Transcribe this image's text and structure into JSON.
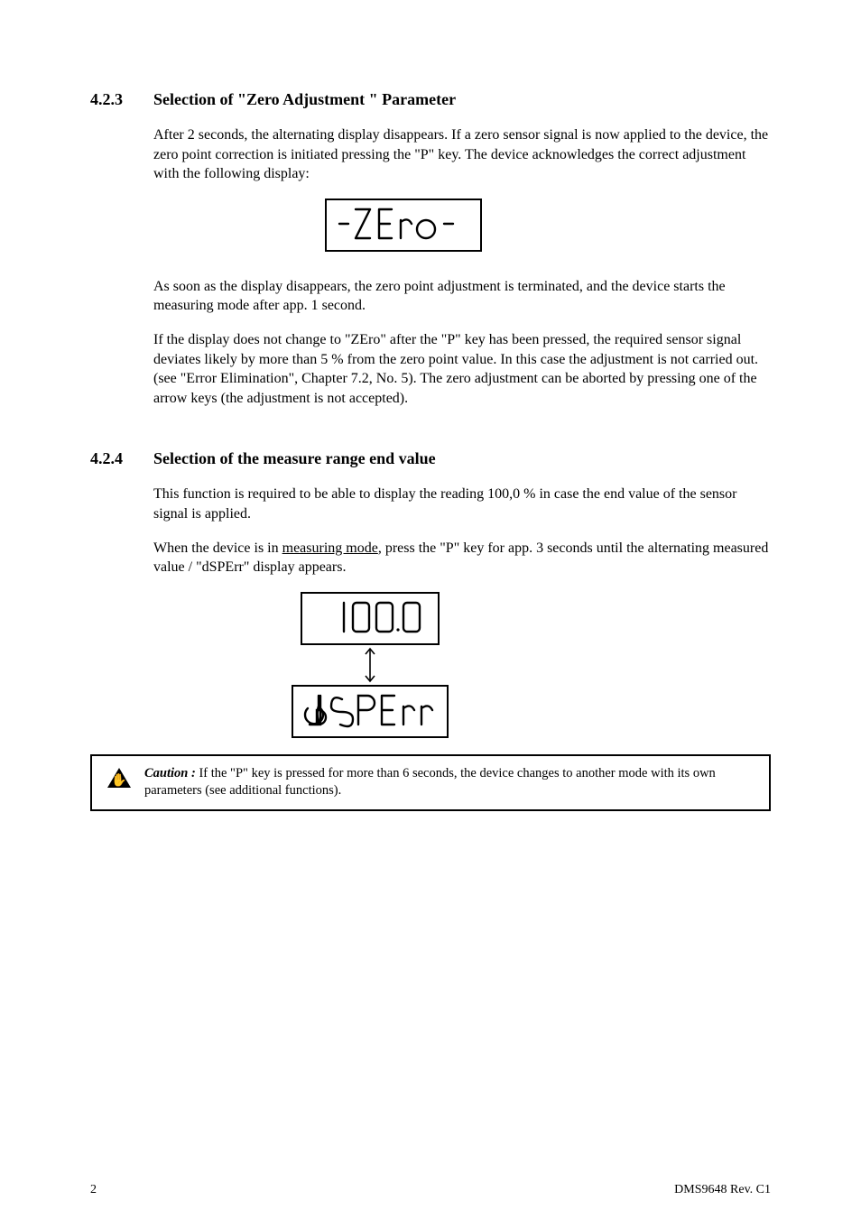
{
  "section1": {
    "num": "4.2.3",
    "title": "Selection of  \"Zero Adjustment \" Parameter",
    "para1": "After 2 seconds, the alternating display disappears. If a zero sensor signal is now applied to the device, the zero point correction is initiated pressing the \"P\" key. The device acknowledges the correct adjustment with the following display:",
    "para2": "As soon as the display disappears, the zero point adjustment is terminated, and the device starts the measuring mode after app. 1 second.",
    "para3": "If the display does not change to \"ZEro\" after the \"P\" key has been pressed, the required sensor signal deviates likely by more than 5 % from the zero point value. In this case the adjustment is not carried out. (see \"Error Elimination\", Chapter 7.2, No. 5). The zero adjustment can be aborted by pressing one of the arrow keys (the adjustment is not accepted).",
    "lcd": "-ZEro-"
  },
  "section2": {
    "num": "4.2.4",
    "title": "Selection of the measure range end value",
    "para1": "This function is required to be able to display the reading 100,0 % in case the end value of the sensor signal is applied.",
    "para2_prefix": "When the device is in ",
    "para2_underline": "measuring mode",
    "para2_suffix": ", press the \"P\" key for app. 3 seconds until the alternating measured value / \"dSPErr\" display appears.",
    "lcd_top": "100.0",
    "lcd_bottom": "dSPErr"
  },
  "warning": {
    "bold": "Caution :",
    "rest": " If the \"P\" key is pressed for more than 6 seconds, the device changes to another mode with its own parameters (see additional functions)."
  },
  "footer": {
    "left": "2",
    "right": "DMS9648    Rev. C1"
  }
}
